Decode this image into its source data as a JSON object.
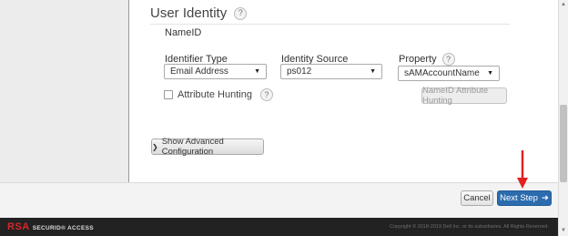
{
  "section": {
    "title": "User Identity",
    "help_glyph": "?"
  },
  "nameid": {
    "label": "NameID"
  },
  "fields": {
    "identifier_type": {
      "label": "Identifier Type",
      "value": "Email Address"
    },
    "identity_source": {
      "label": "Identity Source",
      "value": "ps012"
    },
    "property": {
      "label": "Property",
      "value": "sAMAccountName"
    }
  },
  "attribute_hunting": {
    "label": "Attribute Hunting",
    "checked": false
  },
  "buttons": {
    "nameid_attribute_hunting": "NameID Attribute Hunting",
    "show_advanced": "Show Advanced Configuration",
    "cancel": "Cancel",
    "next_step": "Next Step"
  },
  "footer": {
    "logo_mark": "RSA",
    "logo_text": "SECURID® ACCESS",
    "copyright": "Copyright © 2018-2019 Dell Inc. or its subsidiaries. All Rights Reserved."
  },
  "icons": {
    "caret": "caret-down-icon",
    "chevron": "chevron-down-icon",
    "next_arrow": "arrow-right-icon",
    "annotation": "red-arrow-annotation"
  },
  "colors": {
    "primary": "#2b6cae",
    "annotation": "#e02020",
    "logo_red": "#d8262b",
    "footer_bg": "#222222"
  }
}
